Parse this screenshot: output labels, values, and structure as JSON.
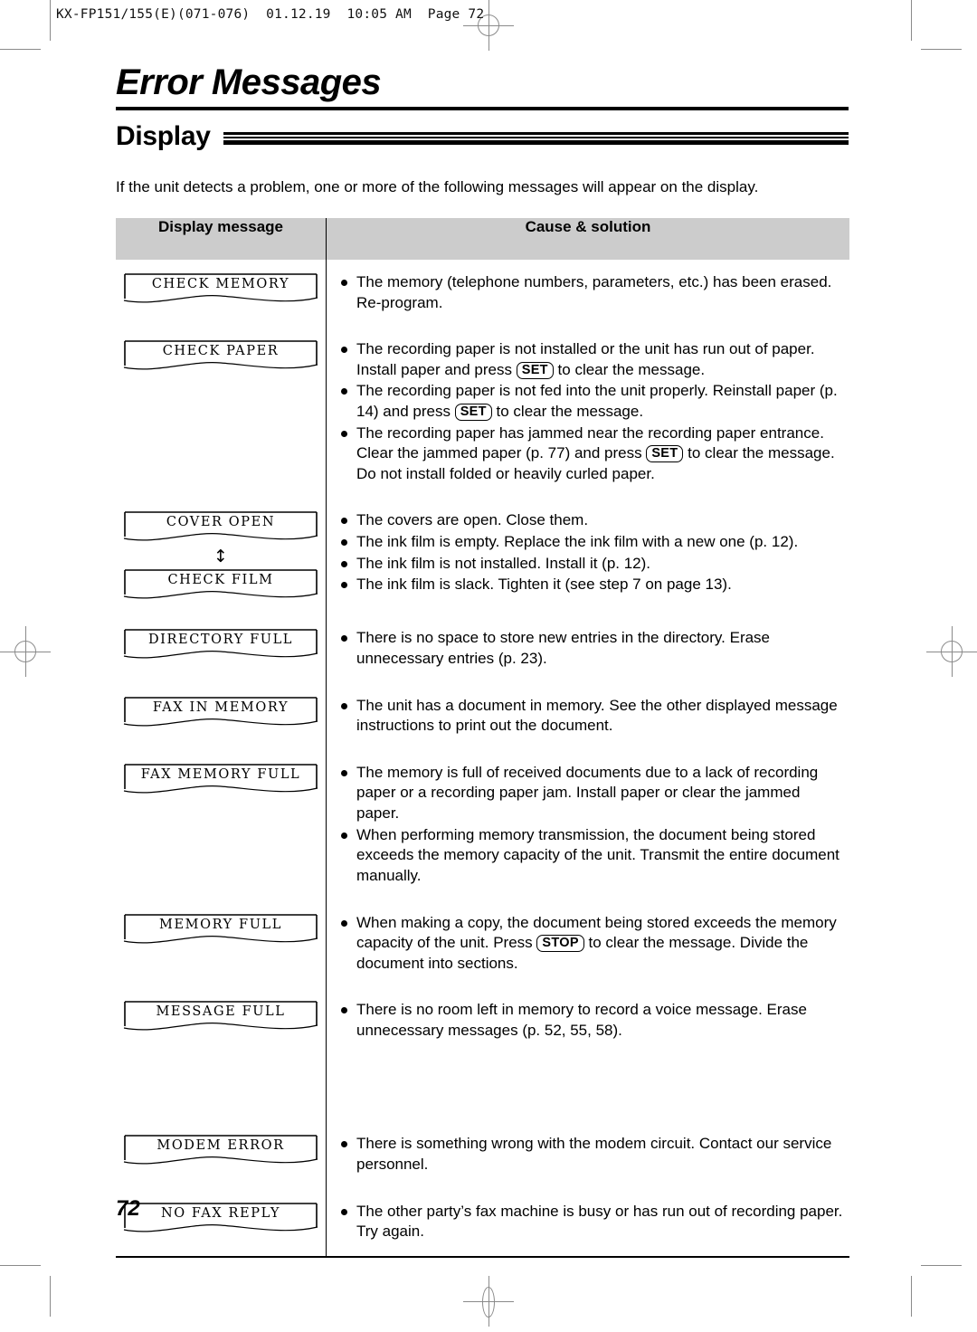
{
  "filestamp": "KX-FP151/155(E)(071-076)  01.12.19  10:05 AM  Page 72",
  "chapter_title": "Error Messages",
  "section_title": "Display",
  "intro": "If the unit detects a problem, one or more of the following messages will appear on the display.",
  "page_number": "72",
  "keys": {
    "set": "SET",
    "stop": "STOP"
  },
  "arrow_glyph": "↕",
  "colors": {
    "header_fill": "#cccccc",
    "rule": "#000000",
    "crop_mark": "#8a8a8a"
  },
  "table": {
    "headers": [
      "Display message",
      "Cause & solution"
    ],
    "rows": [
      {
        "displays": [
          "CHECK MEMORY"
        ],
        "arrow_between": false,
        "bullets": [
          [
            {
              "t": "The memory (telephone numbers, parameters, etc.) has been erased. Re-program."
            }
          ]
        ]
      },
      {
        "displays": [
          "CHECK PAPER"
        ],
        "arrow_between": false,
        "bullets": [
          [
            {
              "t": "The recording paper is not installed or the unit has run out of paper. Install paper and press "
            },
            {
              "key": "SET"
            },
            {
              "t": " to clear the message."
            }
          ],
          [
            {
              "t": "The recording paper is not fed into the unit properly. Reinstall paper (p. 14) and press "
            },
            {
              "key": "SET"
            },
            {
              "t": " to clear the message."
            }
          ],
          [
            {
              "t": "The recording paper has jammed near the recording paper entrance. Clear the jammed paper (p. 77) and press "
            },
            {
              "key": "SET"
            },
            {
              "t": " to clear the message. Do not install folded or heavily curled paper."
            }
          ]
        ]
      },
      {
        "displays": [
          "COVER OPEN",
          "CHECK FILM"
        ],
        "arrow_between": true,
        "bullets": [
          [
            {
              "t": "The covers are open. Close them."
            }
          ],
          [
            {
              "t": "The ink film is empty. Replace the ink film with a new one (p. 12)."
            }
          ],
          [
            {
              "t": "The ink film is not installed. Install it (p. 12)."
            }
          ],
          [
            {
              "t": "The ink film is slack. Tighten it (see step 7 on page 13)."
            }
          ]
        ]
      },
      {
        "displays": [
          "DIRECTORY FULL"
        ],
        "arrow_between": false,
        "bullets": [
          [
            {
              "t": "There is no space to store new entries in the directory. Erase unnecessary entries (p. 23)."
            }
          ]
        ]
      },
      {
        "displays": [
          "FAX IN MEMORY"
        ],
        "arrow_between": false,
        "bullets": [
          [
            {
              "t": "The unit has a document in memory. See the other displayed message instructions to print out the document."
            }
          ]
        ]
      },
      {
        "displays": [
          "FAX MEMORY FULL"
        ],
        "arrow_between": false,
        "bullets": [
          [
            {
              "t": "The memory is full of received documents due to a lack of recording paper or a recording paper jam. Install paper or clear the jammed paper."
            }
          ],
          [
            {
              "t": "When performing memory transmission, the document being stored exceeds the memory capacity of the unit. Transmit the entire document manually."
            }
          ]
        ]
      },
      {
        "displays": [
          "MEMORY FULL"
        ],
        "arrow_between": false,
        "bullets": [
          [
            {
              "t": "When making a copy, the document being stored exceeds the memory capacity of the unit. Press "
            },
            {
              "key": "STOP"
            },
            {
              "t": " to clear the message. Divide the document into sections."
            }
          ]
        ]
      },
      {
        "displays": [
          "MESSAGE FULL"
        ],
        "arrow_between": false,
        "min_height": 120,
        "bullets": [
          [
            {
              "t": "There is no room left in memory to record a voice message. Erase unnecessary messages (p. 52, 55, 58)."
            }
          ]
        ]
      },
      {
        "displays": [
          "MODEM ERROR"
        ],
        "arrow_between": false,
        "bullets": [
          [
            {
              "t": "There is something wrong with the modem circuit. Contact our service personnel."
            }
          ]
        ]
      },
      {
        "displays": [
          "NO FAX REPLY"
        ],
        "arrow_between": false,
        "bullets": [
          [
            {
              "t": "The other party’s fax machine is busy or has run out of recording paper. Try again."
            }
          ]
        ]
      }
    ]
  }
}
